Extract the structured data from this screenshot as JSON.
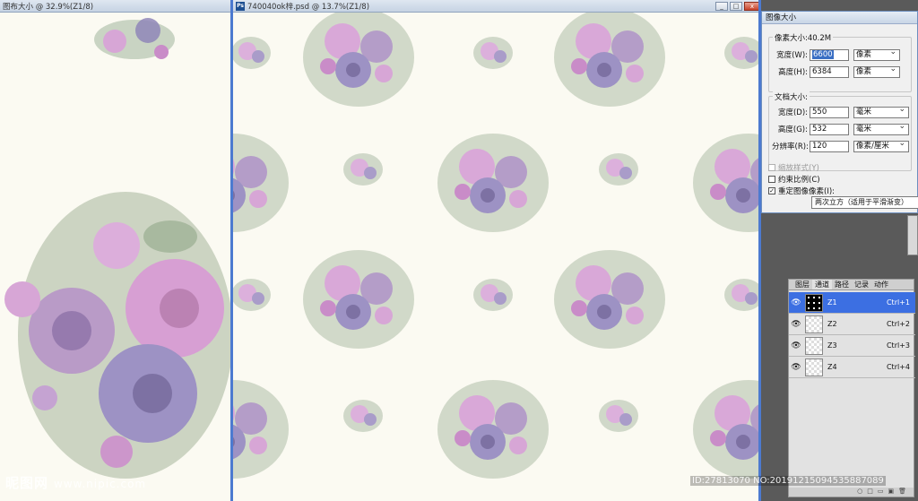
{
  "left_window": {
    "title": "图布大小 @ 32.9%(Z1/8)"
  },
  "main_window": {
    "title": "740040ok梓.psd @ 13.7%(Z1/8)",
    "min": "_",
    "max": "□",
    "close": "x"
  },
  "image_size_dialog": {
    "title": "图像大小",
    "pixel_group_label": "像素大小:40.2M",
    "pixel_width_label": "宽度(W):",
    "pixel_width_value": "6600",
    "pixel_width_unit": "像素",
    "pixel_height_label": "高度(H):",
    "pixel_height_value": "6384",
    "pixel_height_unit": "像素",
    "doc_group_label": "文档大小:",
    "doc_width_label": "宽度(D):",
    "doc_width_value": "550",
    "doc_width_unit": "毫米",
    "doc_height_label": "高度(G):",
    "doc_height_value": "532",
    "doc_height_unit": "毫米",
    "resolution_label": "分辨率(R):",
    "resolution_value": "120",
    "resolution_unit": "像素/厘米",
    "scale_styles": "缩放样式(Y)",
    "constrain": "约束比例(C)",
    "resample": "重定图像像素(I):",
    "resample_method": "两次立方（适用于平滑渐变）",
    "check_mark": "✓"
  },
  "layers_panel": {
    "tabs": [
      "图层",
      "通道",
      "路径",
      "记录",
      "动作"
    ],
    "eye": "👁",
    "layers": [
      {
        "name": "Z1",
        "shortcut": "Ctrl+1"
      },
      {
        "name": "Z2",
        "shortcut": "Ctrl+2"
      },
      {
        "name": "Z3",
        "shortcut": "Ctrl+3"
      },
      {
        "name": "Z4",
        "shortcut": "Ctrl+4"
      }
    ],
    "bottom_icons": [
      "○",
      "□",
      "▭",
      "▣",
      "🗑"
    ]
  },
  "watermark": {
    "text": "昵图网",
    "url": "www.nipic.com"
  },
  "id_line": "ID:27813070 NO:20191215094535887089",
  "colors": {
    "flower_pink": "#c98cc8",
    "flower_violet": "#8f86b8",
    "leaf_green": "#8aa184",
    "canvas_bg": "#fbfaf2",
    "selected_layer": "#3c6fe2"
  }
}
